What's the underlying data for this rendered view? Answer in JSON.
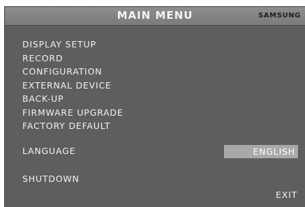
{
  "header": {
    "title": "MAIN MENU",
    "brand": "SAMSUNG"
  },
  "menu": {
    "items": [
      "DISPLAY SETUP",
      "RECORD",
      "CONFIGURATION",
      "EXTERNAL DEVICE",
      "BACK-UP",
      "FIRMWARE UPGRADE",
      "FACTORY DEFAULT"
    ]
  },
  "language": {
    "label": "LANGUAGE",
    "value": "ENGLISH"
  },
  "shutdown_label": "SHUTDOWN",
  "exit_label": "EXIT",
  "colors": {
    "background": "#5e5e5e",
    "title_bar": "#868686",
    "highlight": "#a9a9a9",
    "text": "#f2f2f2"
  }
}
